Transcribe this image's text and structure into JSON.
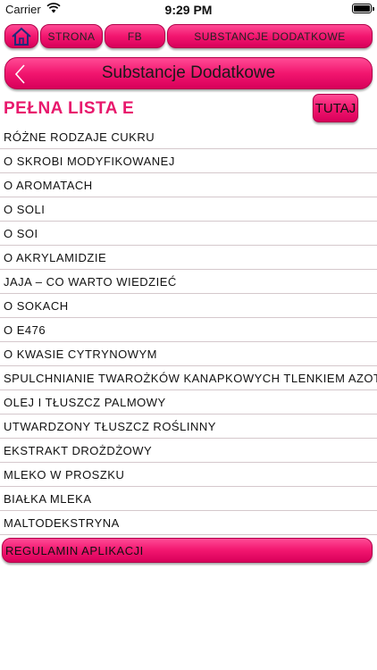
{
  "status": {
    "carrier": "Carrier",
    "time": "9:29 PM"
  },
  "top_nav": {
    "home_icon": "home-icon",
    "strona": "STRONA",
    "fb": "FB",
    "substancje": "SUBSTANCJE DODATKOWE"
  },
  "title_bar": {
    "back_icon": "chevron-left-icon",
    "title": "Substancje Dodatkowe"
  },
  "section": {
    "heading": "PEŁNA LISTA E",
    "tutaj": "TUTAJ"
  },
  "list": [
    "RÓŻNE RODZAJE CUKRU",
    "O SKROBI MODYFIKOWANEJ",
    "O AROMATACH",
    "O SOLI",
    "O SOI",
    "O AKRYLAMIDZIE",
    "JAJA – CO WARTO WIEDZIEĆ",
    "O SOKACH",
    "O E476",
    "O KWASIE CYTRYNOWYM",
    "SPULCHNIANIE TWAROŻKÓW KANAPKOWYCH TLENKIEM AZOTU",
    "OLEJ I TŁUSZCZ PALMOWY",
    "UTWARDZONY TŁUSZCZ ROŚLINNY",
    "EKSTRAKT DROŻDŻOWY",
    "MLEKO W PROSZKU",
    "BIAŁKA MLEKA",
    "MALTODEKSTRYNA"
  ],
  "footer": {
    "regulamin": "REGULAMIN APLIKACJI"
  },
  "colors": {
    "accent": "#f2166f",
    "heading": "#e8186c"
  }
}
